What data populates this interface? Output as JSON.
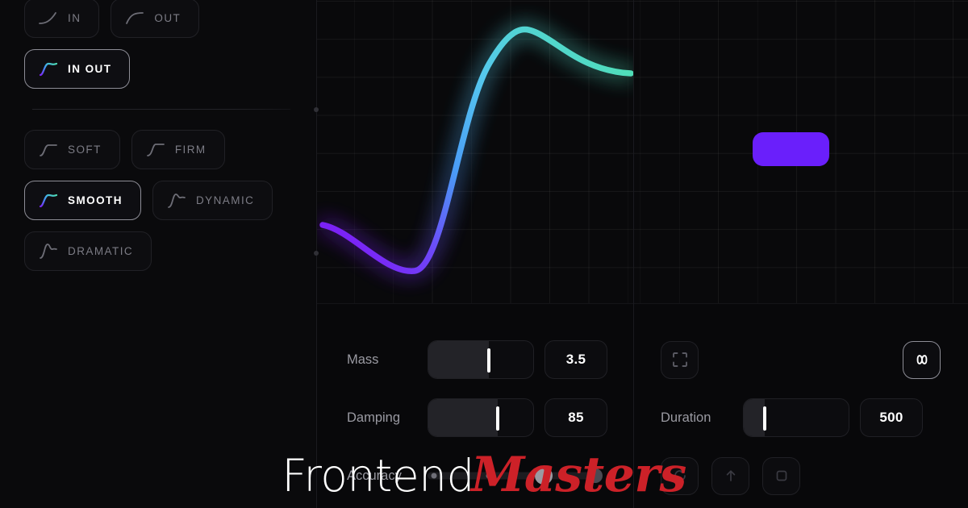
{
  "app": {
    "name": "easing-curve-editor",
    "background": "#08080a",
    "accent": "#6a1ffb"
  },
  "sidebar": {
    "direction_group": {
      "options": [
        {
          "label": "IN",
          "icon": "ease-in-curve-icon",
          "selected": false
        },
        {
          "label": "OUT",
          "icon": "ease-out-curve-icon",
          "selected": false
        },
        {
          "label": "IN OUT",
          "icon": "ease-in-out-curve-icon",
          "selected": true
        }
      ]
    },
    "style_group": {
      "options": [
        {
          "label": "SOFT",
          "icon": "soft-curve-icon",
          "selected": false
        },
        {
          "label": "FIRM",
          "icon": "firm-curve-icon",
          "selected": false
        },
        {
          "label": "SMOOTH",
          "icon": "smooth-curve-icon",
          "selected": true
        },
        {
          "label": "DYNAMIC",
          "icon": "dynamic-curve-icon",
          "selected": false
        },
        {
          "label": "DRAMATIC",
          "icon": "dramatic-curve-icon",
          "selected": false
        }
      ]
    }
  },
  "curve_panel": {
    "grid": true,
    "gradient": {
      "start": "#7b22f5",
      "mid": "#4aa8f5",
      "end": "#4fe0b4"
    }
  },
  "preview_panel": {
    "object": {
      "shape": "rounded-rect",
      "color": "#6a1ffb"
    },
    "grid": true
  },
  "controls": {
    "mass": {
      "label": "Mass",
      "value": "3.5",
      "slider_percent": 58
    },
    "damping": {
      "label": "Damping",
      "value": "85",
      "slider_percent": 66
    },
    "accuracy": {
      "label": "Accuracy",
      "steps": 4,
      "selected_index": 2
    }
  },
  "preview_controls": {
    "fit_button": {
      "icon": "frame-focus-icon",
      "label": "",
      "active": false
    },
    "loop_button": {
      "icon": "infinity-loop-icon",
      "label": "",
      "active": true
    },
    "duration": {
      "label": "Duration",
      "value": "500",
      "slider_percent": 20
    }
  },
  "watermark": {
    "text_light": "Frontend",
    "text_bold": "Masters",
    "color_light": "#ffffff",
    "color_bold": "#cc2128"
  }
}
